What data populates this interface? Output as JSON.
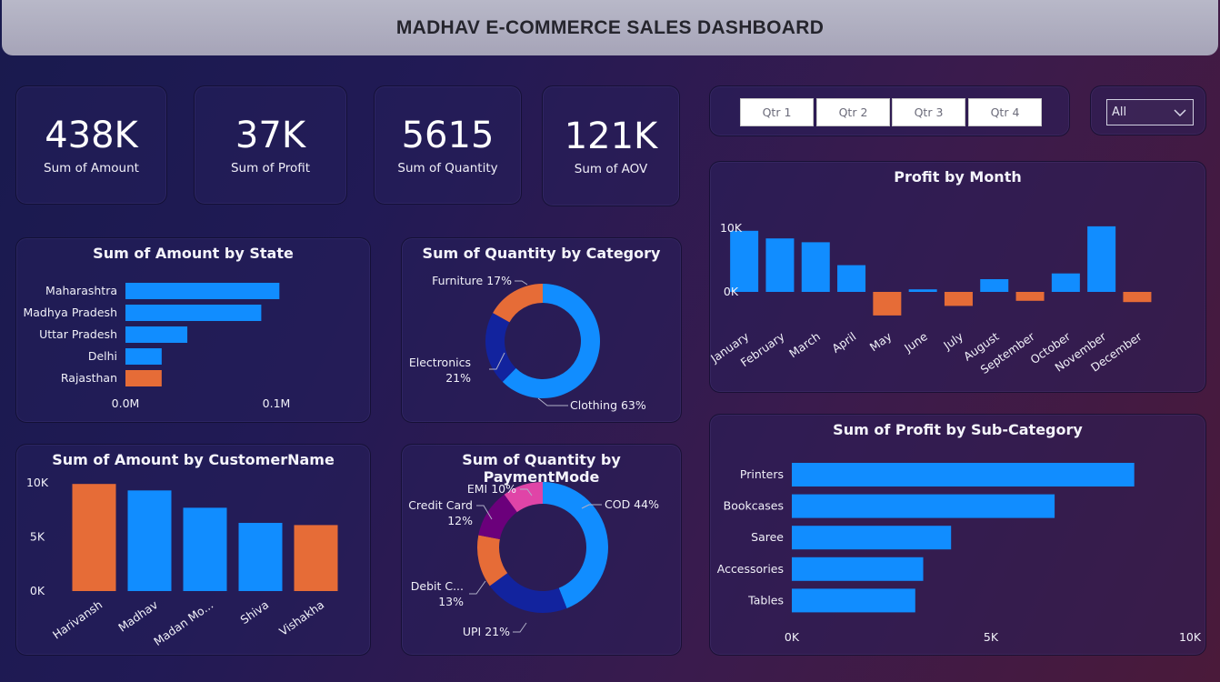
{
  "header": {
    "title": "MADHAV E-COMMERCE SALES DASHBOARD"
  },
  "kpis": [
    {
      "value": "438K",
      "label": "Sum of Amount"
    },
    {
      "value": "37K",
      "label": "Sum of Profit"
    },
    {
      "value": "5615",
      "label": "Sum of Quantity"
    },
    {
      "value": "121K",
      "label": "Sum of AOV"
    }
  ],
  "slicer": {
    "quarters": [
      "Qtr 1",
      "Qtr 2",
      "Qtr 3",
      "Qtr 4"
    ],
    "dropdown_value": "All"
  },
  "colors": {
    "blue": "#118dff",
    "orange": "#e66c37",
    "navy": "#12239e",
    "purple": "#6b007b",
    "pink": "#e044a7"
  },
  "chart_data": [
    {
      "id": "amount-by-state",
      "type": "bar",
      "orientation": "horizontal",
      "title": "Sum of Amount by State",
      "categories": [
        "Maharashtra",
        "Madhya Pradesh",
        "Uttar Pradesh",
        "Delhi",
        "Rajasthan"
      ],
      "values": [
        0.102,
        0.09,
        0.041,
        0.024,
        0.024
      ],
      "colors": [
        "#118dff",
        "#118dff",
        "#118dff",
        "#118dff",
        "#e66c37"
      ],
      "xticks": [
        "0.0M",
        "0.1M"
      ],
      "xlim": [
        0,
        0.1
      ]
    },
    {
      "id": "quantity-by-category",
      "type": "pie",
      "variant": "donut",
      "title": "Sum of Quantity by Category",
      "slices": [
        {
          "label": "Clothing",
          "pct": "63%",
          "value": 63,
          "color": "#118dff"
        },
        {
          "label": "Electronics",
          "pct": "21%",
          "value": 21,
          "color": "#12239e"
        },
        {
          "label": "Furniture",
          "pct": "17%",
          "value": 17,
          "color": "#e66c37"
        }
      ]
    },
    {
      "id": "profit-by-month",
      "type": "bar",
      "title": "Profit by Month",
      "categories": [
        "January",
        "February",
        "March",
        "April",
        "May",
        "June",
        "July",
        "August",
        "September",
        "October",
        "November",
        "December"
      ],
      "values": [
        9600,
        8400,
        7800,
        4200,
        -3700,
        400,
        -2200,
        2000,
        -1400,
        2900,
        10300,
        -1600
      ],
      "yticks": [
        "0K",
        "10K"
      ],
      "ylim": [
        -4000,
        11000
      ]
    },
    {
      "id": "amount-by-customer",
      "type": "bar",
      "title": "Sum of Amount by CustomerName",
      "categories": [
        "Harivansh",
        "Madhav",
        "Madan Mo...",
        "Shiva",
        "Vishakha"
      ],
      "values": [
        9900,
        9300,
        7700,
        6300,
        6100
      ],
      "colors": [
        "#e66c37",
        "#118dff",
        "#118dff",
        "#118dff",
        "#e66c37"
      ],
      "yticks": [
        "0K",
        "5K",
        "10K"
      ],
      "ylim": [
        0,
        10000
      ]
    },
    {
      "id": "quantity-by-paymentmode",
      "type": "pie",
      "variant": "donut",
      "title": "Sum of Quantity by PaymentMode",
      "slices": [
        {
          "label": "COD",
          "pct": "44%",
          "value": 44,
          "color": "#118dff"
        },
        {
          "label": "UPI",
          "pct": "21%",
          "value": 21,
          "color": "#12239e"
        },
        {
          "label": "Debit C...",
          "pct": "13%",
          "value": 13,
          "color": "#e66c37"
        },
        {
          "label": "Credit Card",
          "pct": "12%",
          "value": 12,
          "color": "#6b007b"
        },
        {
          "label": "EMI",
          "pct": "10%",
          "value": 10,
          "color": "#e044a7"
        }
      ]
    },
    {
      "id": "profit-by-subcategory",
      "type": "bar",
      "orientation": "horizontal",
      "title": "Sum of Profit by Sub-Category",
      "categories": [
        "Printers",
        "Bookcases",
        "Saree",
        "Accessories",
        "Tables"
      ],
      "values": [
        8600,
        6600,
        4000,
        3300,
        3100
      ],
      "xticks": [
        "0K",
        "5K",
        "10K"
      ],
      "xlim": [
        0,
        10000
      ]
    }
  ]
}
